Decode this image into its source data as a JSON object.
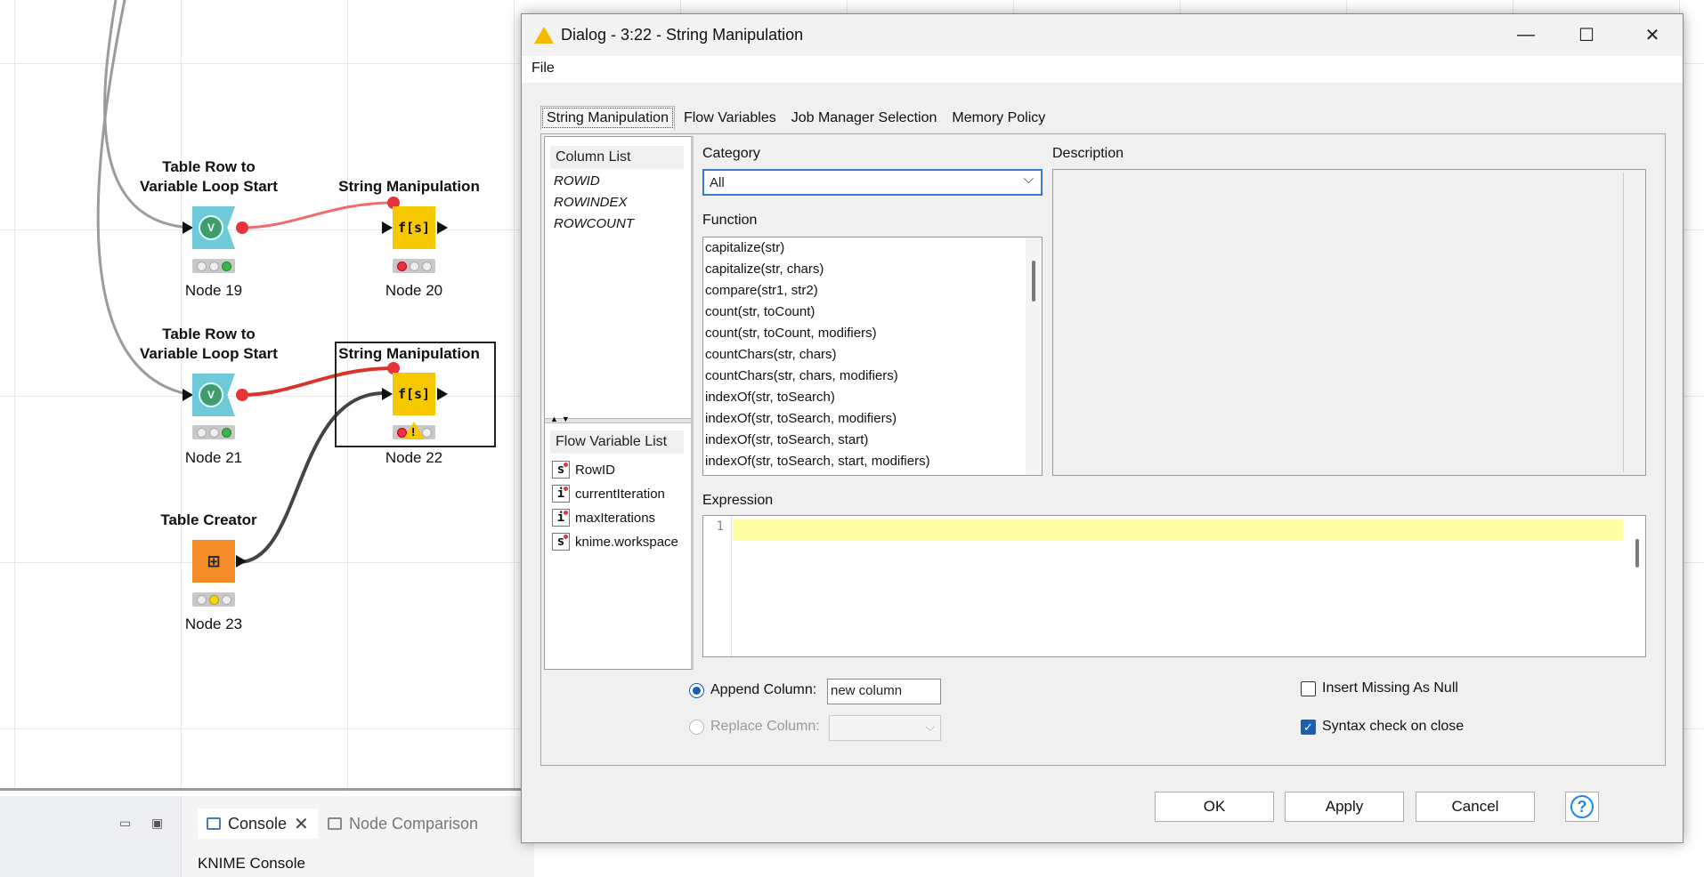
{
  "canvas": {
    "nodes": [
      {
        "title_line1": "Table Row to",
        "title_line2": "Variable Loop Start",
        "icon_text": "V",
        "label": "Node 19"
      },
      {
        "title_line1": "String Manipulation",
        "icon_text": "f[s]",
        "label": "Node 20"
      },
      {
        "title_line1": "Table Row to",
        "title_line2": "Variable Loop Start",
        "icon_text": "V",
        "label": "Node 21"
      },
      {
        "title_line1": "String Manipulation",
        "icon_text": "f[s]",
        "label": "Node 22",
        "warning": "!"
      },
      {
        "title_line1": "Table Creator",
        "icon_text": "⊞",
        "label": "Node 23"
      }
    ]
  },
  "bottom": {
    "console_tab": "Console",
    "node_comparison_tab": "Node Comparison",
    "console_title": "KNIME Console"
  },
  "dialog": {
    "title": "Dialog - 3:22 - String Manipulation",
    "menu_file": "File",
    "tabs": [
      "String Manipulation",
      "Flow Variables",
      "Job Manager Selection",
      "Memory Policy"
    ],
    "column_list": {
      "header": "Column List",
      "items": [
        "ROWID",
        "ROWINDEX",
        "ROWCOUNT"
      ]
    },
    "flow_variable_list": {
      "header": "Flow Variable List",
      "items": [
        {
          "type": "s",
          "name": "RowID"
        },
        {
          "type": "i",
          "name": "currentIteration"
        },
        {
          "type": "i",
          "name": "maxIterations"
        },
        {
          "type": "s",
          "name": "knime.workspace"
        }
      ]
    },
    "category_label": "Category",
    "category_value": "All",
    "function_label": "Function",
    "functions": [
      "capitalize(str)",
      "capitalize(str, chars)",
      "compare(str1, str2)",
      "count(str, toCount)",
      "count(str, toCount, modifiers)",
      "countChars(str, chars)",
      "countChars(str, chars, modifiers)",
      "indexOf(str, toSearch)",
      "indexOf(str, toSearch, modifiers)",
      "indexOf(str, toSearch, start)",
      "indexOf(str, toSearch, start, modifiers)"
    ],
    "description_label": "Description",
    "expression_label": "Expression",
    "expression_line_number": "1",
    "append_column_label": "Append Column:",
    "append_column_value": "new column",
    "replace_column_label": "Replace Column:",
    "insert_missing_label": "Insert Missing As Null",
    "syntax_check_label": "Syntax check on close",
    "ok_label": "OK",
    "apply_label": "Apply",
    "cancel_label": "Cancel",
    "help_label": "?"
  },
  "colors": {
    "accent": "#1a5fb4",
    "loop_node": "#6fc9d8",
    "string_node": "#f6c800",
    "creator_node": "#f28c28",
    "variable_connection": "#e8333a"
  }
}
